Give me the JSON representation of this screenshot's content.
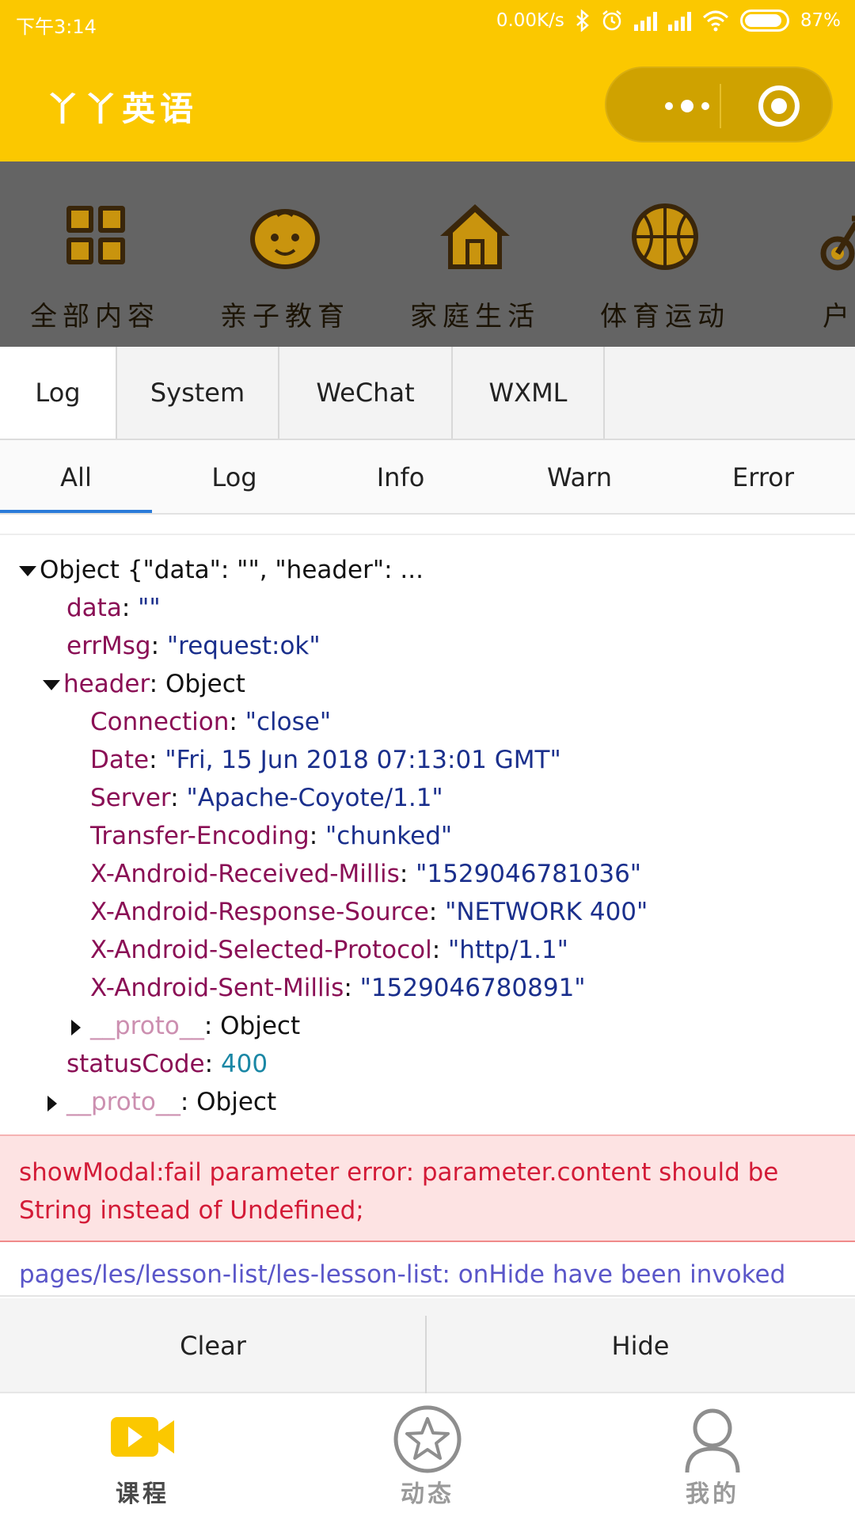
{
  "status_bar": {
    "time": "下午3:14",
    "net_speed": "0.00K/s",
    "battery": "87%"
  },
  "nav": {
    "title": "丫丫英语",
    "more_icon": "more-dots-icon",
    "close_icon": "target-icon"
  },
  "categories": [
    {
      "label": "全部内容",
      "icon": "grid-icon"
    },
    {
      "label": "亲子教育",
      "icon": "baby-face-icon"
    },
    {
      "label": "家庭生活",
      "icon": "house-icon"
    },
    {
      "label": "体育运动",
      "icon": "basketball-icon"
    },
    {
      "label": "户外",
      "icon": "bicycle-icon"
    }
  ],
  "console": {
    "tabs": [
      "Log",
      "System",
      "WeChat",
      "WXML"
    ],
    "active_tab": "Log",
    "filters": [
      "All",
      "Log",
      "Info",
      "Warn",
      "Error"
    ],
    "active_filter": "All"
  },
  "log": {
    "object_summary": "Object {\"data\": \"\", \"header\": ...",
    "data_key": "data",
    "data_val": "\"\"",
    "errmsg_key": "errMsg",
    "errmsg_val": "\"request:ok\"",
    "header_key": "header",
    "header_type": "Object",
    "headers": [
      {
        "k": "Connection",
        "v": "\"close\""
      },
      {
        "k": "Date",
        "v": "\"Fri, 15 Jun 2018 07:13:01 GMT\""
      },
      {
        "k": "Server",
        "v": "\"Apache-Coyote/1.1\""
      },
      {
        "k": "Transfer-Encoding",
        "v": "\"chunked\""
      },
      {
        "k": "X-Android-Received-Millis",
        "v": "\"1529046781036\""
      },
      {
        "k": "X-Android-Response-Source",
        "v": "\"NETWORK 400\""
      },
      {
        "k": "X-Android-Selected-Protocol",
        "v": "\"http/1.1\""
      },
      {
        "k": "X-Android-Sent-Millis",
        "v": "\"1529046780891\""
      }
    ],
    "proto_key": "__proto__",
    "proto_type": "Object",
    "status_key": "statusCode",
    "status_val": "400",
    "colon": ":"
  },
  "error_message": "showModal:fail parameter error: parameter.content should be String instead of Undefined;",
  "info_message": "pages/les/lesson-list/les-lesson-list: onHide have been invoked",
  "actions": {
    "clear": "Clear",
    "hide": "Hide"
  },
  "tabbar": [
    {
      "label": "课程",
      "icon": "video-icon",
      "active": true
    },
    {
      "label": "动态",
      "icon": "star-icon",
      "active": false
    },
    {
      "label": "我的",
      "icon": "user-icon",
      "active": false
    }
  ],
  "colors": {
    "brand": "#fbc800",
    "category_bg": "#646464",
    "error_text": "#d31b37",
    "error_bg": "#fde3e3",
    "info_text": "#5a56c9",
    "active_filter": "#2b7bd9"
  }
}
